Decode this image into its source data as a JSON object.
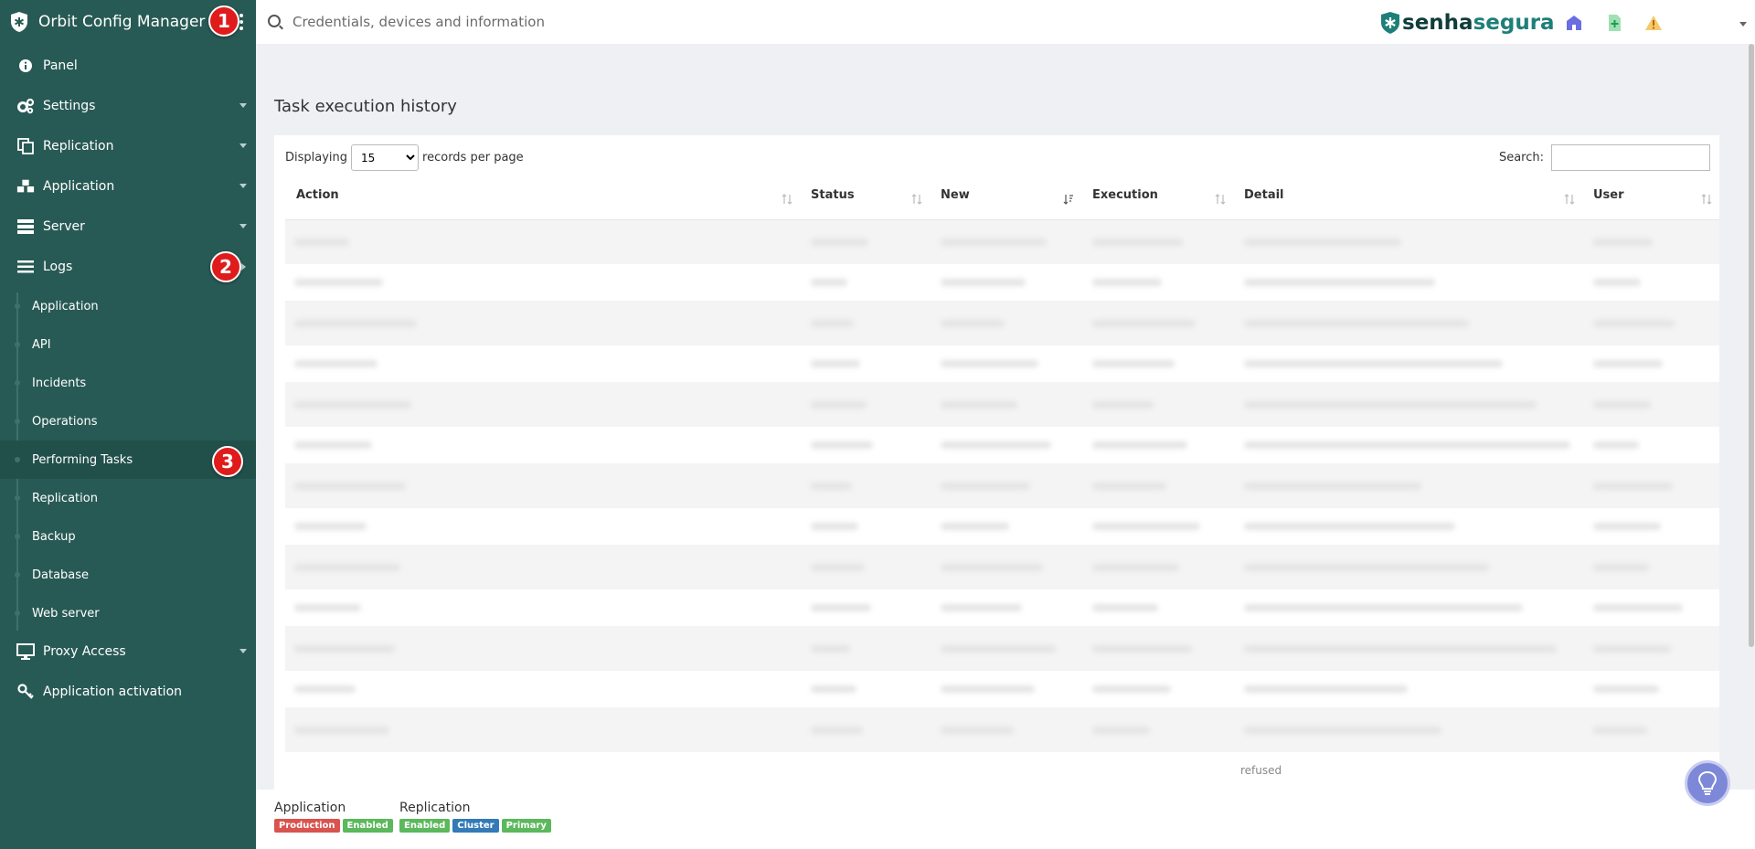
{
  "app": {
    "title": "Orbit Config Manager"
  },
  "search": {
    "placeholder": "Credentials, devices and information"
  },
  "brand": {
    "wordmark_part1": "senha",
    "wordmark_part2": "segura"
  },
  "topbar_icons": [
    "home-icon",
    "add-document-icon",
    "warning-icon"
  ],
  "sidebar": {
    "items": [
      {
        "label": "Panel",
        "icon": "info-icon",
        "caret": false
      },
      {
        "label": "Settings",
        "icon": "gears-icon",
        "caret": true
      },
      {
        "label": "Replication",
        "icon": "copy-icon",
        "caret": true
      },
      {
        "label": "Application",
        "icon": "cubes-icon",
        "caret": true
      },
      {
        "label": "Server",
        "icon": "server-icon",
        "caret": true
      },
      {
        "label": "Logs",
        "icon": "list-icon",
        "caret": true,
        "expanded": true
      },
      {
        "label": "Proxy Access",
        "icon": "monitor-icon",
        "caret": true
      },
      {
        "label": "Application activation",
        "icon": "key-icon",
        "caret": false
      }
    ],
    "logs_subitems": [
      {
        "label": "Application"
      },
      {
        "label": "API"
      },
      {
        "label": "Incidents"
      },
      {
        "label": "Operations"
      },
      {
        "label": "Performing Tasks",
        "active": true
      },
      {
        "label": "Replication"
      },
      {
        "label": "Backup"
      },
      {
        "label": "Database"
      },
      {
        "label": "Web server"
      }
    ]
  },
  "annotations": [
    "1",
    "2",
    "3"
  ],
  "page": {
    "title": "Task execution history"
  },
  "table": {
    "length_prefix": "Displaying",
    "length_value": "15",
    "length_options": [
      "15"
    ],
    "length_suffix": "records per page",
    "search_label": "Search:",
    "columns": [
      "Action",
      "Status",
      "New",
      "Execution",
      "Detail",
      "User"
    ],
    "row_count": 13,
    "overflow_text": "refused"
  },
  "footer": {
    "groups": [
      {
        "title": "Application",
        "tags": [
          {
            "text": "Production",
            "color": "#d9534f"
          },
          {
            "text": "Enabled",
            "color": "#5cb85c"
          }
        ]
      },
      {
        "title": "Replication",
        "tags": [
          {
            "text": "Enabled",
            "color": "#5cb85c"
          },
          {
            "text": "Cluster",
            "color": "#337ab7"
          },
          {
            "text": "Primary",
            "color": "#5cb85c"
          }
        ]
      }
    ]
  },
  "colors": {
    "sidebar": "#285a55",
    "accent": "#1e7f78",
    "annotation": "#e01b1b",
    "help_button": "#7d88d8"
  }
}
